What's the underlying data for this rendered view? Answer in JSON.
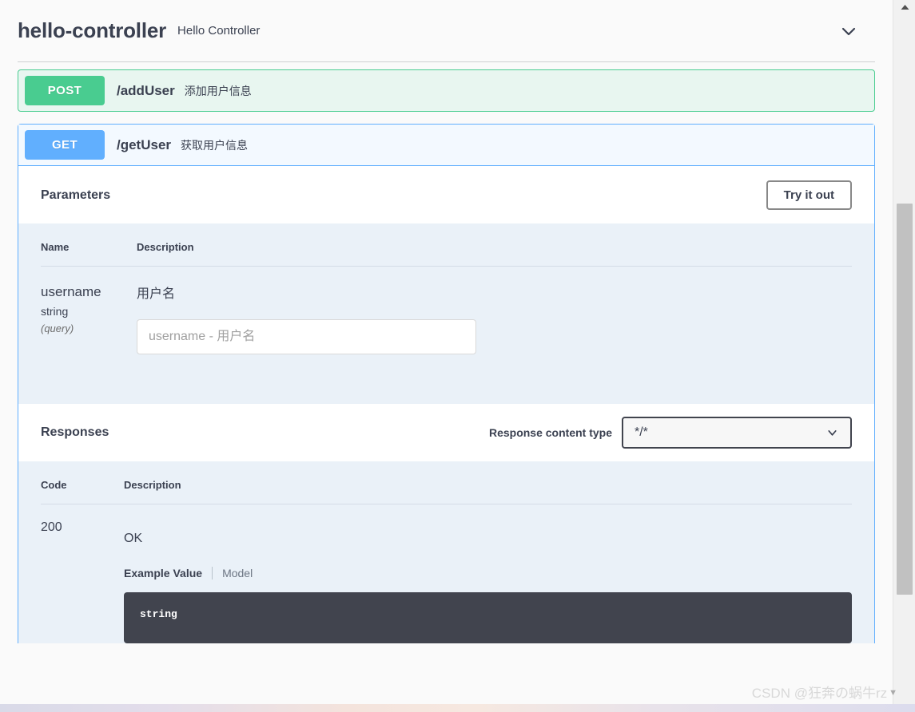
{
  "tag": {
    "name": "hello-controller",
    "description": "Hello Controller",
    "collapse_icon": "chevron-down-icon"
  },
  "operations": [
    {
      "method": "POST",
      "path": "/addUser",
      "summary": "添加用户信息",
      "color": "#49cc90",
      "expanded": false
    },
    {
      "method": "GET",
      "path": "/getUser",
      "summary": "获取用户信息",
      "color": "#61affe",
      "expanded": true
    }
  ],
  "parameters_section": {
    "title": "Parameters",
    "try_it_out_label": "Try it out",
    "columns": {
      "name": "Name",
      "description": "Description"
    },
    "rows": [
      {
        "name": "username",
        "type": "string",
        "in": "(query)",
        "description": "用户名",
        "input_value": "",
        "input_placeholder": "username - 用户名"
      }
    ]
  },
  "responses_section": {
    "title": "Responses",
    "content_type_label": "Response content type",
    "content_type_value": "*/*",
    "content_type_options": [
      "*/*"
    ],
    "columns": {
      "code": "Code",
      "description": "Description"
    },
    "rows": [
      {
        "code": "200",
        "description": "OK",
        "example_tab_label": "Example Value",
        "model_tab_label": "Model",
        "example_code": "string"
      }
    ]
  },
  "watermark": {
    "text": "CSDN @狂奔の蜗牛rz"
  },
  "scrollbar": {
    "up_arrow_icon": "triangle-up-icon"
  },
  "colors": {
    "post": "#49cc90",
    "get": "#61affe",
    "code_block_bg": "#41444e",
    "table_bg": "#eaf1f8"
  }
}
